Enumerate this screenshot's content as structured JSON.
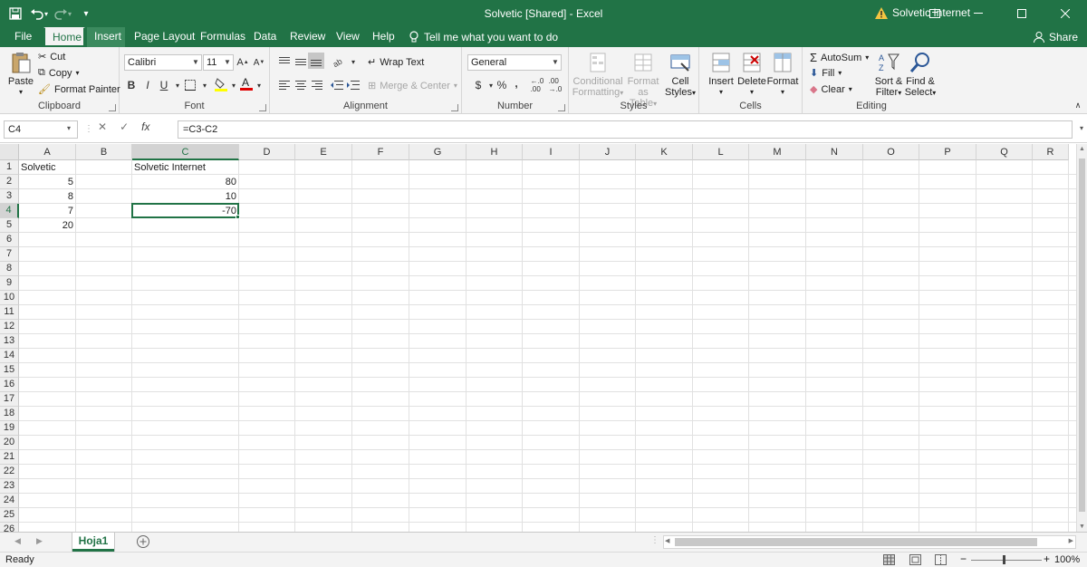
{
  "window": {
    "title": "Solvetic  [Shared]  -  Excel",
    "account_label": "Solvetic Internet",
    "warning_icon": "warning-icon"
  },
  "tabs": [
    "File",
    "Home",
    "Insert",
    "Page Layout",
    "Formulas",
    "Data",
    "Review",
    "View",
    "Help"
  ],
  "tell_me": "Tell me what you want to do",
  "share_label": "Share",
  "clipboard": {
    "paste": "Paste",
    "cut": "Cut",
    "copy": "Copy",
    "format_painter": "Format Painter",
    "label": "Clipboard"
  },
  "font": {
    "name": "Calibri",
    "size": "11",
    "bold": "B",
    "italic": "I",
    "underline": "U",
    "label": "Font"
  },
  "alignment": {
    "wrap_text": "Wrap Text",
    "merge_center": "Merge & Center",
    "label": "Alignment"
  },
  "number": {
    "format": "General",
    "currency": "$",
    "percent": "%",
    "comma": ",",
    "label": "Number"
  },
  "styles": {
    "conditional_1": "Conditional",
    "conditional_2": "Formatting",
    "format_table_1": "Format as",
    "format_table_2": "Table",
    "cell_styles_1": "Cell",
    "cell_styles_2": "Styles",
    "label": "Styles"
  },
  "cells": {
    "insert": "Insert",
    "delete": "Delete",
    "format": "Format",
    "label": "Cells"
  },
  "editing": {
    "autosum": "AutoSum",
    "fill": "Fill",
    "clear": "Clear",
    "sort_1": "Sort &",
    "sort_2": "Filter",
    "find_1": "Find &",
    "find_2": "Select",
    "label": "Editing"
  },
  "formula_bar": {
    "name_box": "C4",
    "formula": "=C3-C2",
    "fx": "fx"
  },
  "columns": [
    "A",
    "B",
    "C",
    "D",
    "E",
    "F",
    "G",
    "H",
    "I",
    "J",
    "K",
    "L",
    "M",
    "N",
    "O",
    "P",
    "Q",
    "R"
  ],
  "rows": [
    "1",
    "2",
    "3",
    "4",
    "5",
    "6",
    "7",
    "8",
    "9",
    "10",
    "11",
    "12",
    "13",
    "14",
    "15",
    "16",
    "17",
    "18",
    "19",
    "20",
    "21",
    "22",
    "23",
    "24",
    "25",
    "26"
  ],
  "cells_data": {
    "A1": "Solvetic",
    "C1": "Solvetic Internet",
    "A2": "5",
    "C2": "80",
    "A3": "8",
    "C3": "10",
    "A4": "7",
    "C4": "-70",
    "A5": "20"
  },
  "selected_cell": "C4",
  "sheet": {
    "name": "Hoja1",
    "add_icon": "plus-circle-icon"
  },
  "status": {
    "ready": "Ready",
    "zoom": "100%",
    "minus": "−",
    "plus": "+"
  },
  "colors": {
    "accent": "#217346"
  }
}
